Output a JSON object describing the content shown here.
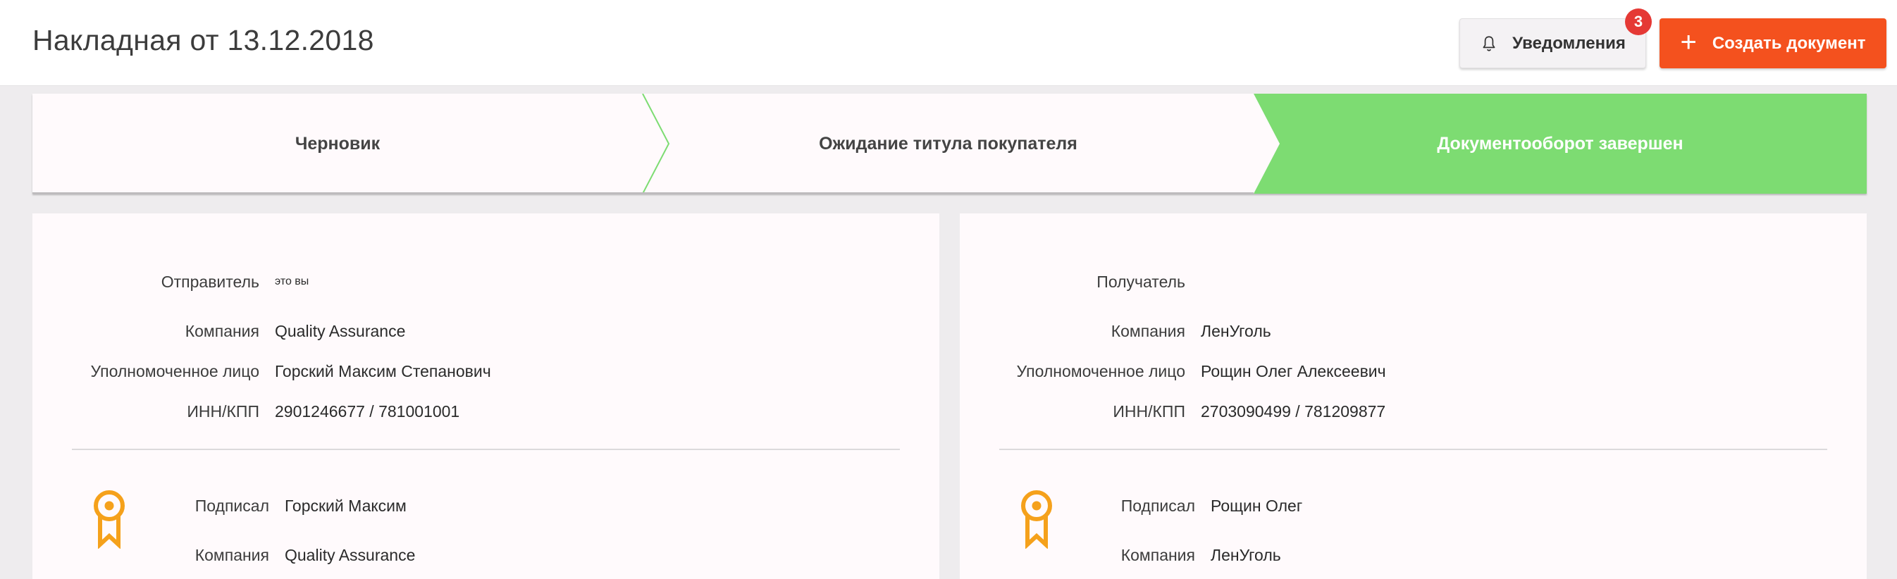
{
  "header": {
    "title": "Накладная от 13.12.2018",
    "notifications_label": "Уведомления",
    "notifications_count": "3",
    "create_label": "Создать документ",
    "create_icon": "plus-icon",
    "notifications_icon": "bell-icon"
  },
  "colors": {
    "accent": "#f4511e",
    "badge": "#e53935",
    "step_done": "#7ddc72",
    "award": "#f5a11b"
  },
  "stepper": {
    "steps": [
      {
        "label": "Черновик",
        "state": "done"
      },
      {
        "label": "Ожидание титула покупателя",
        "state": "done"
      },
      {
        "label": "Документооборот завершен",
        "state": "active"
      }
    ]
  },
  "sender": {
    "role_label": "Отправитель",
    "role_value": "это вы",
    "company_label": "Компания",
    "company_value": "Quality Assurance",
    "person_label": "Уполномоченное лицо",
    "person_value": "Горский Максим Степанович",
    "inn_label": "ИНН/КПП",
    "inn_value": "2901246677 / 781001001",
    "signed_label": "Подписал",
    "signed_value": "Горский Максим",
    "signed_company_label": "Компания",
    "signed_company_value": "Quality Assurance",
    "signature_icon": "award-icon"
  },
  "receiver": {
    "role_label": "Получатель",
    "role_value": "",
    "company_label": "Компания",
    "company_value": "ЛенУголь",
    "person_label": "Уполномоченное лицо",
    "person_value": "Рощин Олег Алексеевич",
    "inn_label": "ИНН/КПП",
    "inn_value": "2703090499 / 781209877",
    "signed_label": "Подписал",
    "signed_value": "Рощин Олег",
    "signed_company_label": "Компания",
    "signed_company_value": "ЛенУголь",
    "signature_icon": "award-icon"
  }
}
